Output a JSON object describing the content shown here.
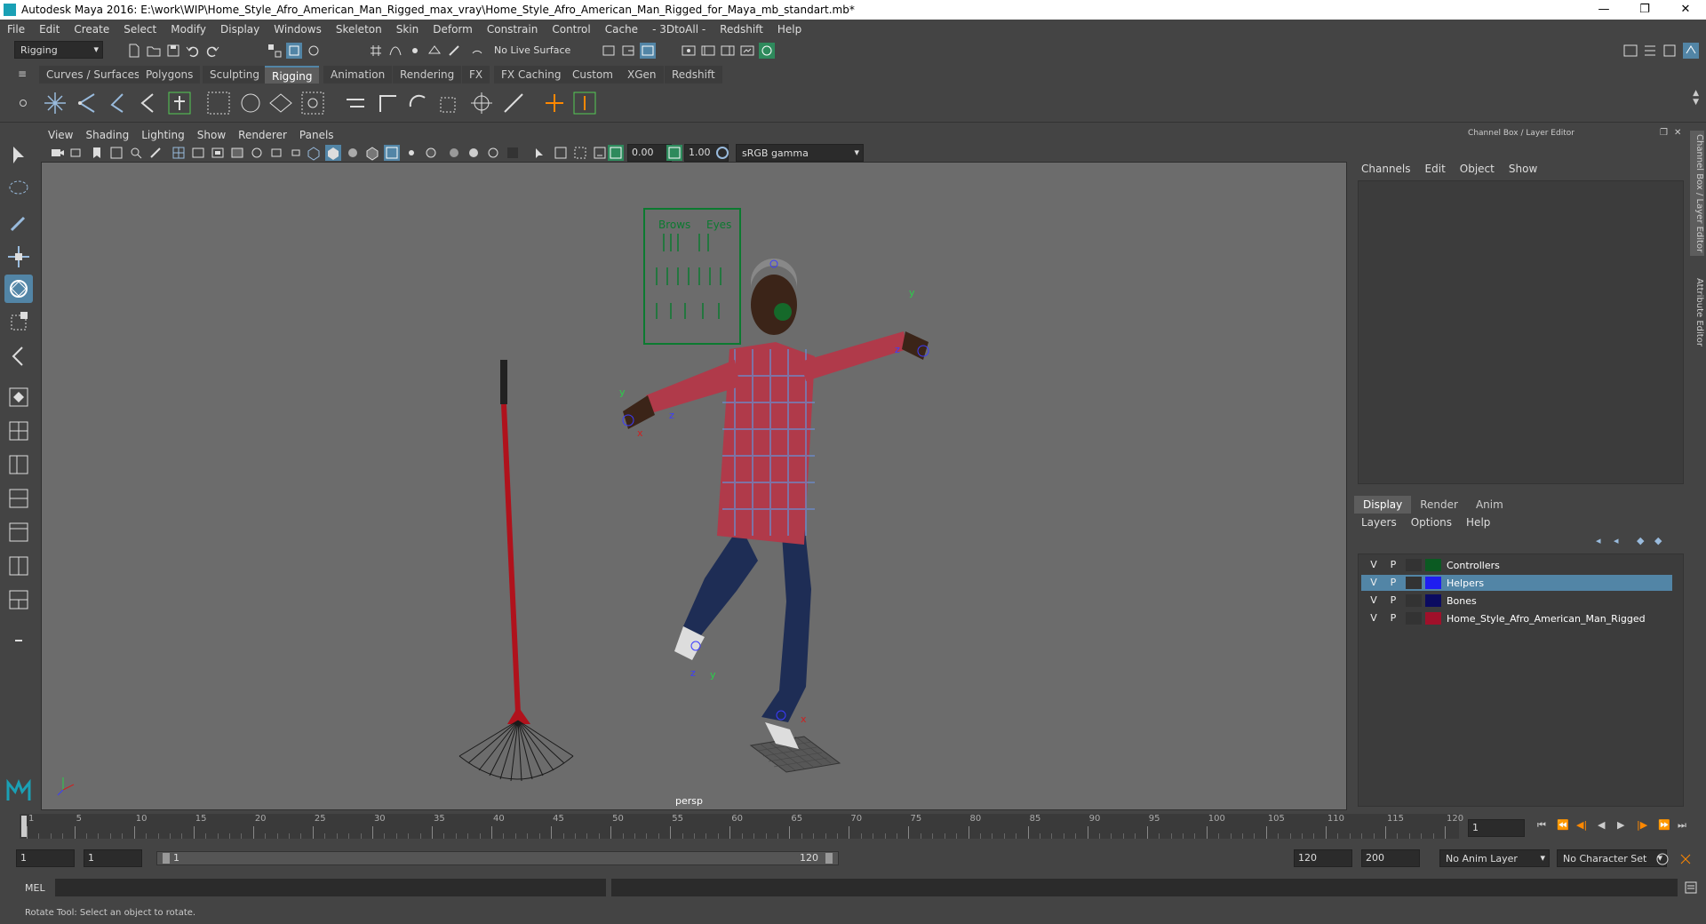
{
  "window": {
    "title": "Autodesk Maya 2016: E:\\work\\WIP\\Home_Style_Afro_American_Man_Rigged_max_vray\\Home_Style_Afro_American_Man_Rigged_for_Maya_mb_standart.mb*",
    "minimize": "—",
    "restore": "❐",
    "close": "✕"
  },
  "menubar": [
    "File",
    "Edit",
    "Create",
    "Select",
    "Modify",
    "Display",
    "Windows",
    "Skeleton",
    "Skin",
    "Deform",
    "Constrain",
    "Control",
    "Cache",
    "- 3DtoAll -",
    "Redshift",
    "Help"
  ],
  "statusline": {
    "mode": "Rigging",
    "live_surface": "No Live Surface"
  },
  "shelf_tabs": [
    "Curves / Surfaces",
    "Polygons",
    "Sculpting",
    "Rigging",
    "Animation",
    "Rendering",
    "FX",
    "FX Caching",
    "Custom",
    "XGen",
    "Redshift"
  ],
  "shelf_active": "Rigging",
  "panel_menu": [
    "View",
    "Shading",
    "Lighting",
    "Show",
    "Renderer",
    "Panels"
  ],
  "panel_toolbar": {
    "exposure": "0.00",
    "gamma": "1.00",
    "color_space": "sRGB gamma"
  },
  "viewport": {
    "camera_label": "persp",
    "chart_labels": {
      "brows": "Brows",
      "eyes": "Eyes"
    }
  },
  "channel_box": {
    "title": "Channel Box / Layer Editor",
    "menu": [
      "Channels",
      "Edit",
      "Object",
      "Show"
    ]
  },
  "layer_editor": {
    "tabs": [
      "Display",
      "Render",
      "Anim"
    ],
    "active_tab": "Display",
    "menu": [
      "Layers",
      "Options",
      "Help"
    ],
    "layers": [
      {
        "v": "V",
        "p": "P",
        "name": "Controllers",
        "color": "#0b5a22",
        "selected": false
      },
      {
        "v": "V",
        "p": "P",
        "name": "Helpers",
        "color": "#1e1ef0",
        "selected": true
      },
      {
        "v": "V",
        "p": "P",
        "name": "Bones",
        "color": "#0b0b60",
        "selected": false
      },
      {
        "v": "V",
        "p": "P",
        "name": "Home_Style_Afro_American_Man_Rigged",
        "color": "#a0102a",
        "selected": false
      }
    ]
  },
  "side_tabs": [
    "Channel Box / Layer Editor",
    "Attribute Editor"
  ],
  "timeline": {
    "ticks": [
      "1",
      "5",
      "10",
      "15",
      "20",
      "25",
      "30",
      "35",
      "40",
      "45",
      "50",
      "55",
      "60",
      "65",
      "70",
      "75",
      "80",
      "85",
      "90",
      "95",
      "100",
      "105",
      "110",
      "115",
      "120"
    ],
    "current_frame": "1"
  },
  "range": {
    "start": "1",
    "anim_start": "1",
    "slider_start": "1",
    "slider_end": "120",
    "anim_end": "120",
    "end": "200",
    "anim_layer": "No Anim Layer",
    "character_set": "No Character Set"
  },
  "command_line": {
    "label": "MEL"
  },
  "help_line": "Rotate Tool: Select an object to rotate.",
  "colors": {
    "accent": "#5285a6",
    "ui_bg": "#444444",
    "viewport_bg": "#6c6c6c"
  }
}
